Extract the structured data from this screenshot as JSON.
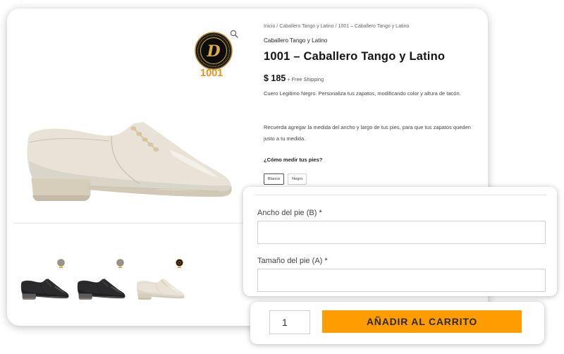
{
  "breadcrumb": {
    "home": "Inicio",
    "category": "Caballero Tango y Latino",
    "current": "1001 – Caballero Tango y Latino",
    "separator": "/"
  },
  "brand_logo": {
    "monogram": "D",
    "text": "1001",
    "icon": "monogram-logo-icon"
  },
  "gallery": {
    "zoom_icon": "magnifier-icon",
    "main_image": {
      "color": "beige"
    },
    "thumbnails": [
      {
        "color": "black",
        "logo": "grey"
      },
      {
        "color": "black",
        "logo": "grey"
      },
      {
        "color": "beige",
        "logo": "black"
      }
    ]
  },
  "product": {
    "category": "Caballero Tango y Latino",
    "title": "1001 – Caballero Tango y Latino",
    "price": "$ 185",
    "shipping": "+ Free Shipping",
    "description": "Cuero Legitimo Negro. Personaliza tus zapatos, modificando color y altura de tacón.",
    "note": "Recuerda agregar la medida del ancho y largo de tus pies, para que tus zapatos queden justo a tu medida.",
    "measure_link": "¿Cómo medir tus pies?",
    "swatches": [
      {
        "label": "Blanco",
        "selected": true
      },
      {
        "label": "Negro",
        "selected": false
      }
    ]
  },
  "form": {
    "width": {
      "label": "Ancho del pie (B)",
      "required": "*",
      "value": ""
    },
    "length": {
      "label": "Tamaño del pie (A)",
      "required": "*",
      "value": ""
    }
  },
  "cart": {
    "quantity": "1",
    "button_label": "AÑADIR AL CARRITO"
  },
  "colors": {
    "accent": "#FF9C00",
    "logo_text": "#E8921E",
    "logo_gold": "#C99A2E"
  }
}
